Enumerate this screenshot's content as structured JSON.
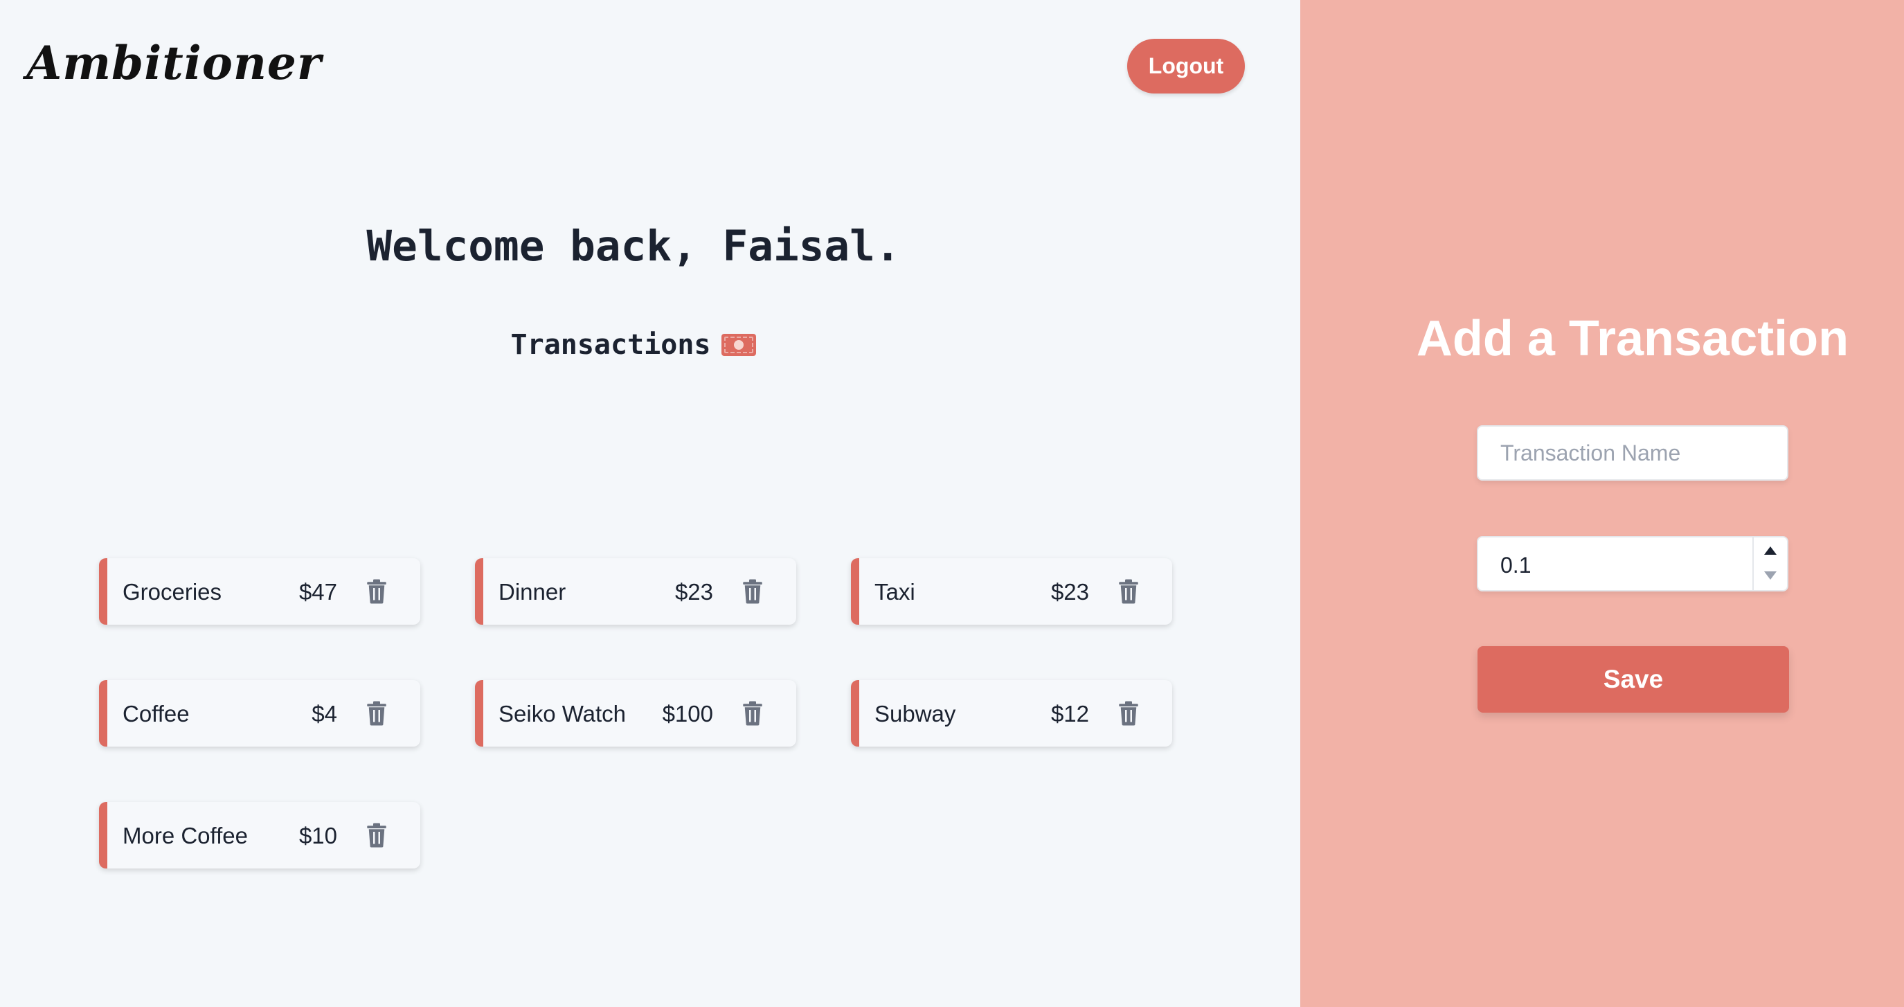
{
  "header": {
    "logo_text": "Ambitioner",
    "logout_label": "Logout"
  },
  "main": {
    "welcome": "Welcome back, Faisal.",
    "transactions_heading": "Transactions",
    "transactions": [
      {
        "name": "Groceries",
        "amount": "$47"
      },
      {
        "name": "Dinner",
        "amount": "$23"
      },
      {
        "name": "Taxi",
        "amount": "$23"
      },
      {
        "name": "Coffee",
        "amount": "$4"
      },
      {
        "name": "Seiko Watch",
        "amount": "$100"
      },
      {
        "name": "Subway",
        "amount": "$12"
      },
      {
        "name": "More Coffee",
        "amount": "$10"
      }
    ]
  },
  "form": {
    "title": "Add a Transaction",
    "name_placeholder": "Transaction Name",
    "amount_value": "0.1",
    "save_label": "Save"
  },
  "colors": {
    "accent": "#dd6b60",
    "panel": "#f2b2a7",
    "background": "#f4f7fa",
    "icon": "#6b7280"
  }
}
